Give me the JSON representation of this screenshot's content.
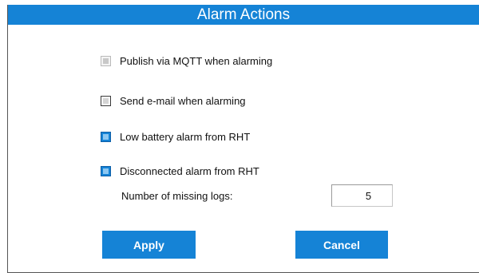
{
  "dialog": {
    "title": "Alarm Actions"
  },
  "options": {
    "mqtt": {
      "label": "Publish via MQTT when alarming",
      "state": "disabled"
    },
    "email": {
      "label": "Send e-mail when alarming",
      "state": "unchecked"
    },
    "low_battery": {
      "label": "Low battery alarm from RHT",
      "state": "checked"
    },
    "disconnected": {
      "label": "Disconnected alarm from RHT",
      "state": "checked"
    }
  },
  "missing_logs": {
    "label": "Number of missing logs:",
    "value": "5"
  },
  "buttons": {
    "apply": "Apply",
    "cancel": "Cancel"
  },
  "colors": {
    "accent": "#1583d6",
    "text": "#111111"
  }
}
